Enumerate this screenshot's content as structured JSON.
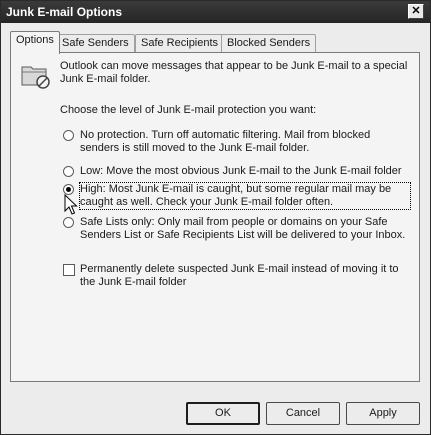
{
  "window": {
    "title": "Junk E-mail Options",
    "close_glyph": "✕"
  },
  "tabs": [
    {
      "label": "Options",
      "active": true
    },
    {
      "label": "Safe Senders",
      "active": false
    },
    {
      "label": "Safe Recipients",
      "active": false
    },
    {
      "label": "Blocked Senders",
      "active": false
    }
  ],
  "panel": {
    "icon": "junk-folder-icon",
    "intro": "Outlook can move messages that appear to be Junk E-mail to a special Junk E-mail folder.",
    "prompt": "Choose the level of Junk E-mail protection you want:",
    "options": [
      {
        "label": "No protection.  Turn off automatic filtering.  Mail from blocked senders is still moved to the Junk E-mail folder.",
        "selected": false
      },
      {
        "label": "Low: Move the most obvious Junk E-mail to the Junk E-mail folder",
        "selected": false
      },
      {
        "label": "High: Most Junk E-mail is caught, but some regular mail may be caught as well. Check your Junk E-mail folder often.",
        "selected": true
      },
      {
        "label": "Safe Lists only: Only mail from people or domains on your Safe Senders List or Safe Recipients List will be delivered to your Inbox.",
        "selected": false
      }
    ],
    "permanent_delete": {
      "label": "Permanently delete suspected Junk E-mail instead of moving it to the Junk E-mail folder",
      "checked": false
    }
  },
  "buttons": {
    "ok": "OK",
    "cancel": "Cancel",
    "apply": "Apply"
  }
}
